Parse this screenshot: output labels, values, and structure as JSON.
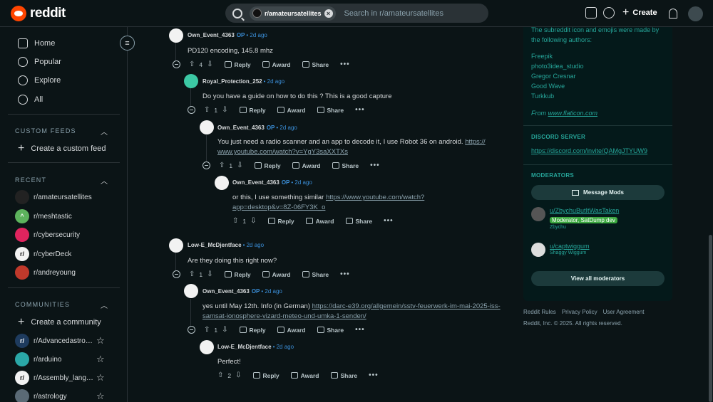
{
  "header": {
    "logo_text": "reddit",
    "search_chip": "r/amateursatellites",
    "search_placeholder": "Search in r/amateursatellites",
    "create_label": "Create"
  },
  "sidebar": {
    "nav": [
      {
        "label": "Home",
        "icon": "home-icon"
      },
      {
        "label": "Popular",
        "icon": "popular-icon"
      },
      {
        "label": "Explore",
        "icon": "explore-icon"
      },
      {
        "label": "All",
        "icon": "all-icon"
      }
    ],
    "custom_feeds_title": "CUSTOM FEEDS",
    "create_custom_feed": "Create a custom feed",
    "recent_title": "RECENT",
    "recent": [
      "r/amateursatellites",
      "r/meshtastic",
      "r/cybersecurity",
      "r/cyberDeck",
      "r/andreyoung"
    ],
    "communities_title": "COMMUNITIES",
    "create_community": "Create a community",
    "communities": [
      "r/Advancedastro…",
      "r/arduino",
      "r/Assembly_lang…",
      "r/astrology"
    ]
  },
  "comments": [
    {
      "author": "Own_Event_4363",
      "op": "OP",
      "time": "• 2d ago",
      "body": "PD120 encoding, 145.8 mhz",
      "votes": "4"
    },
    {
      "author": "Royal_Protection_252",
      "op": "",
      "time": "• 2d ago",
      "body": "Do you have a guide on how to do this ? This is a good capture",
      "votes": "1"
    },
    {
      "author": "Own_Event_4363",
      "op": "OP",
      "time": "• 2d ago",
      "body": "You just need a radio scanner and an app to decode it, I use Robot 36 on android. ",
      "link": "https://\nwww.youtube.com/watch?v=YgY3saXXTXs",
      "votes": "1"
    },
    {
      "author": "Own_Event_4363",
      "op": "OP",
      "time": "• 2d ago",
      "body": "or this, I use something similar ",
      "link": "https://www.youtube.com/watch?\napp=desktop&v=8Z-06FY3K_o",
      "votes": "1"
    },
    {
      "author": "Low-E_McDjentface",
      "op": "",
      "time": "• 2d ago",
      "body": "Are they doing this right now?",
      "votes": "1"
    },
    {
      "author": "Own_Event_4363",
      "op": "OP",
      "time": "• 2d ago",
      "body": "yes until May 12th. Info (in German) ",
      "link": "https://darc-e39.org/allgemein/sstv-feuerwerk-im-mai-2025-iss-\nsamsat-ionosphere-vizard-meteo-und-umka-1-senden/",
      "votes": "1"
    },
    {
      "author": "Low-E_McDjentface",
      "op": "",
      "time": "• 2d ago",
      "body": "Perfect!",
      "votes": "2"
    }
  ],
  "actions": {
    "reply": "Reply",
    "award": "Award",
    "share": "Share",
    "more": "•••"
  },
  "right_panel": {
    "icon_credit": "The subreddit icon and emojis were made by the following authors:",
    "authors": [
      "Freepik",
      "photo3idea_studio",
      "Gregor Cresnar",
      "Good Wave",
      "Turkkub"
    ],
    "from_prefix": "From ",
    "from_link": "www.flaticon.com",
    "discord_title": "DISCORD SERVER",
    "discord_link": "https://discord.com/invite/QAMgJTYUW9",
    "moderators_title": "MODERATORS",
    "message_mods": "Message Mods",
    "mods": [
      {
        "name": "u/ZbychuButItWasTaken",
        "flair": "Moderator, SatDump dev",
        "sub": "Zbychu"
      },
      {
        "name": "u/captwiggum",
        "flair": "",
        "sub": "Shaggy Wiggum"
      }
    ],
    "view_all": "View all moderators"
  },
  "footer": {
    "links": [
      "Reddit Rules",
      "Privacy Policy",
      "User Agreement"
    ],
    "copyright": "Reddit, Inc. © 2025. All rights reserved."
  },
  "colors": {
    "accent": "#ff4500",
    "teal": "#26a69a",
    "op_blue": "#3b8fd9"
  }
}
